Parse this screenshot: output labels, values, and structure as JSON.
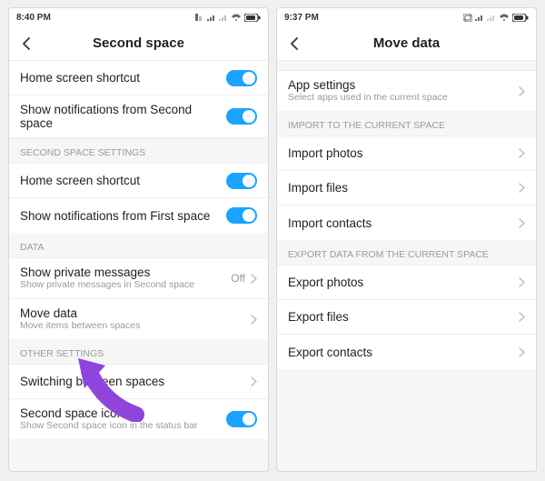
{
  "colors": {
    "accent": "#1aa3ff",
    "arrow": "#8e44dd"
  },
  "left": {
    "status_time": "8:40 PM",
    "header_title": "Second space",
    "rows_top": [
      {
        "label": "Home screen shortcut"
      },
      {
        "label": "Show notifications from Second space"
      }
    ],
    "section1": "SECOND SPACE SETTINGS",
    "rows_sect1": [
      {
        "label": "Home screen shortcut"
      },
      {
        "label": "Show notifications from First space"
      }
    ],
    "section2": "DATA",
    "rows_sect2": [
      {
        "label": "Show private messages",
        "sub": "Show private messages in Second space",
        "value": "Off"
      },
      {
        "label": "Move data",
        "sub": "Move items between spaces"
      }
    ],
    "section3": "OTHER SETTINGS",
    "rows_sect3": [
      {
        "label": "Switching between spaces"
      },
      {
        "label": "Second space icon",
        "sub": "Show Second space icon in the status bar"
      }
    ]
  },
  "right": {
    "status_time": "9:37 PM",
    "header_title": "Move data",
    "app_settings": {
      "label": "App settings",
      "sub": "Select apps used in the current space"
    },
    "section_import": "IMPORT TO THE CURRENT SPACE",
    "import_rows": [
      {
        "label": "Import photos"
      },
      {
        "label": "Import files"
      },
      {
        "label": "Import contacts"
      }
    ],
    "section_export": "EXPORT DATA FROM THE CURRENT SPACE",
    "export_rows": [
      {
        "label": "Export photos"
      },
      {
        "label": "Export files"
      },
      {
        "label": "Export contacts"
      }
    ]
  }
}
